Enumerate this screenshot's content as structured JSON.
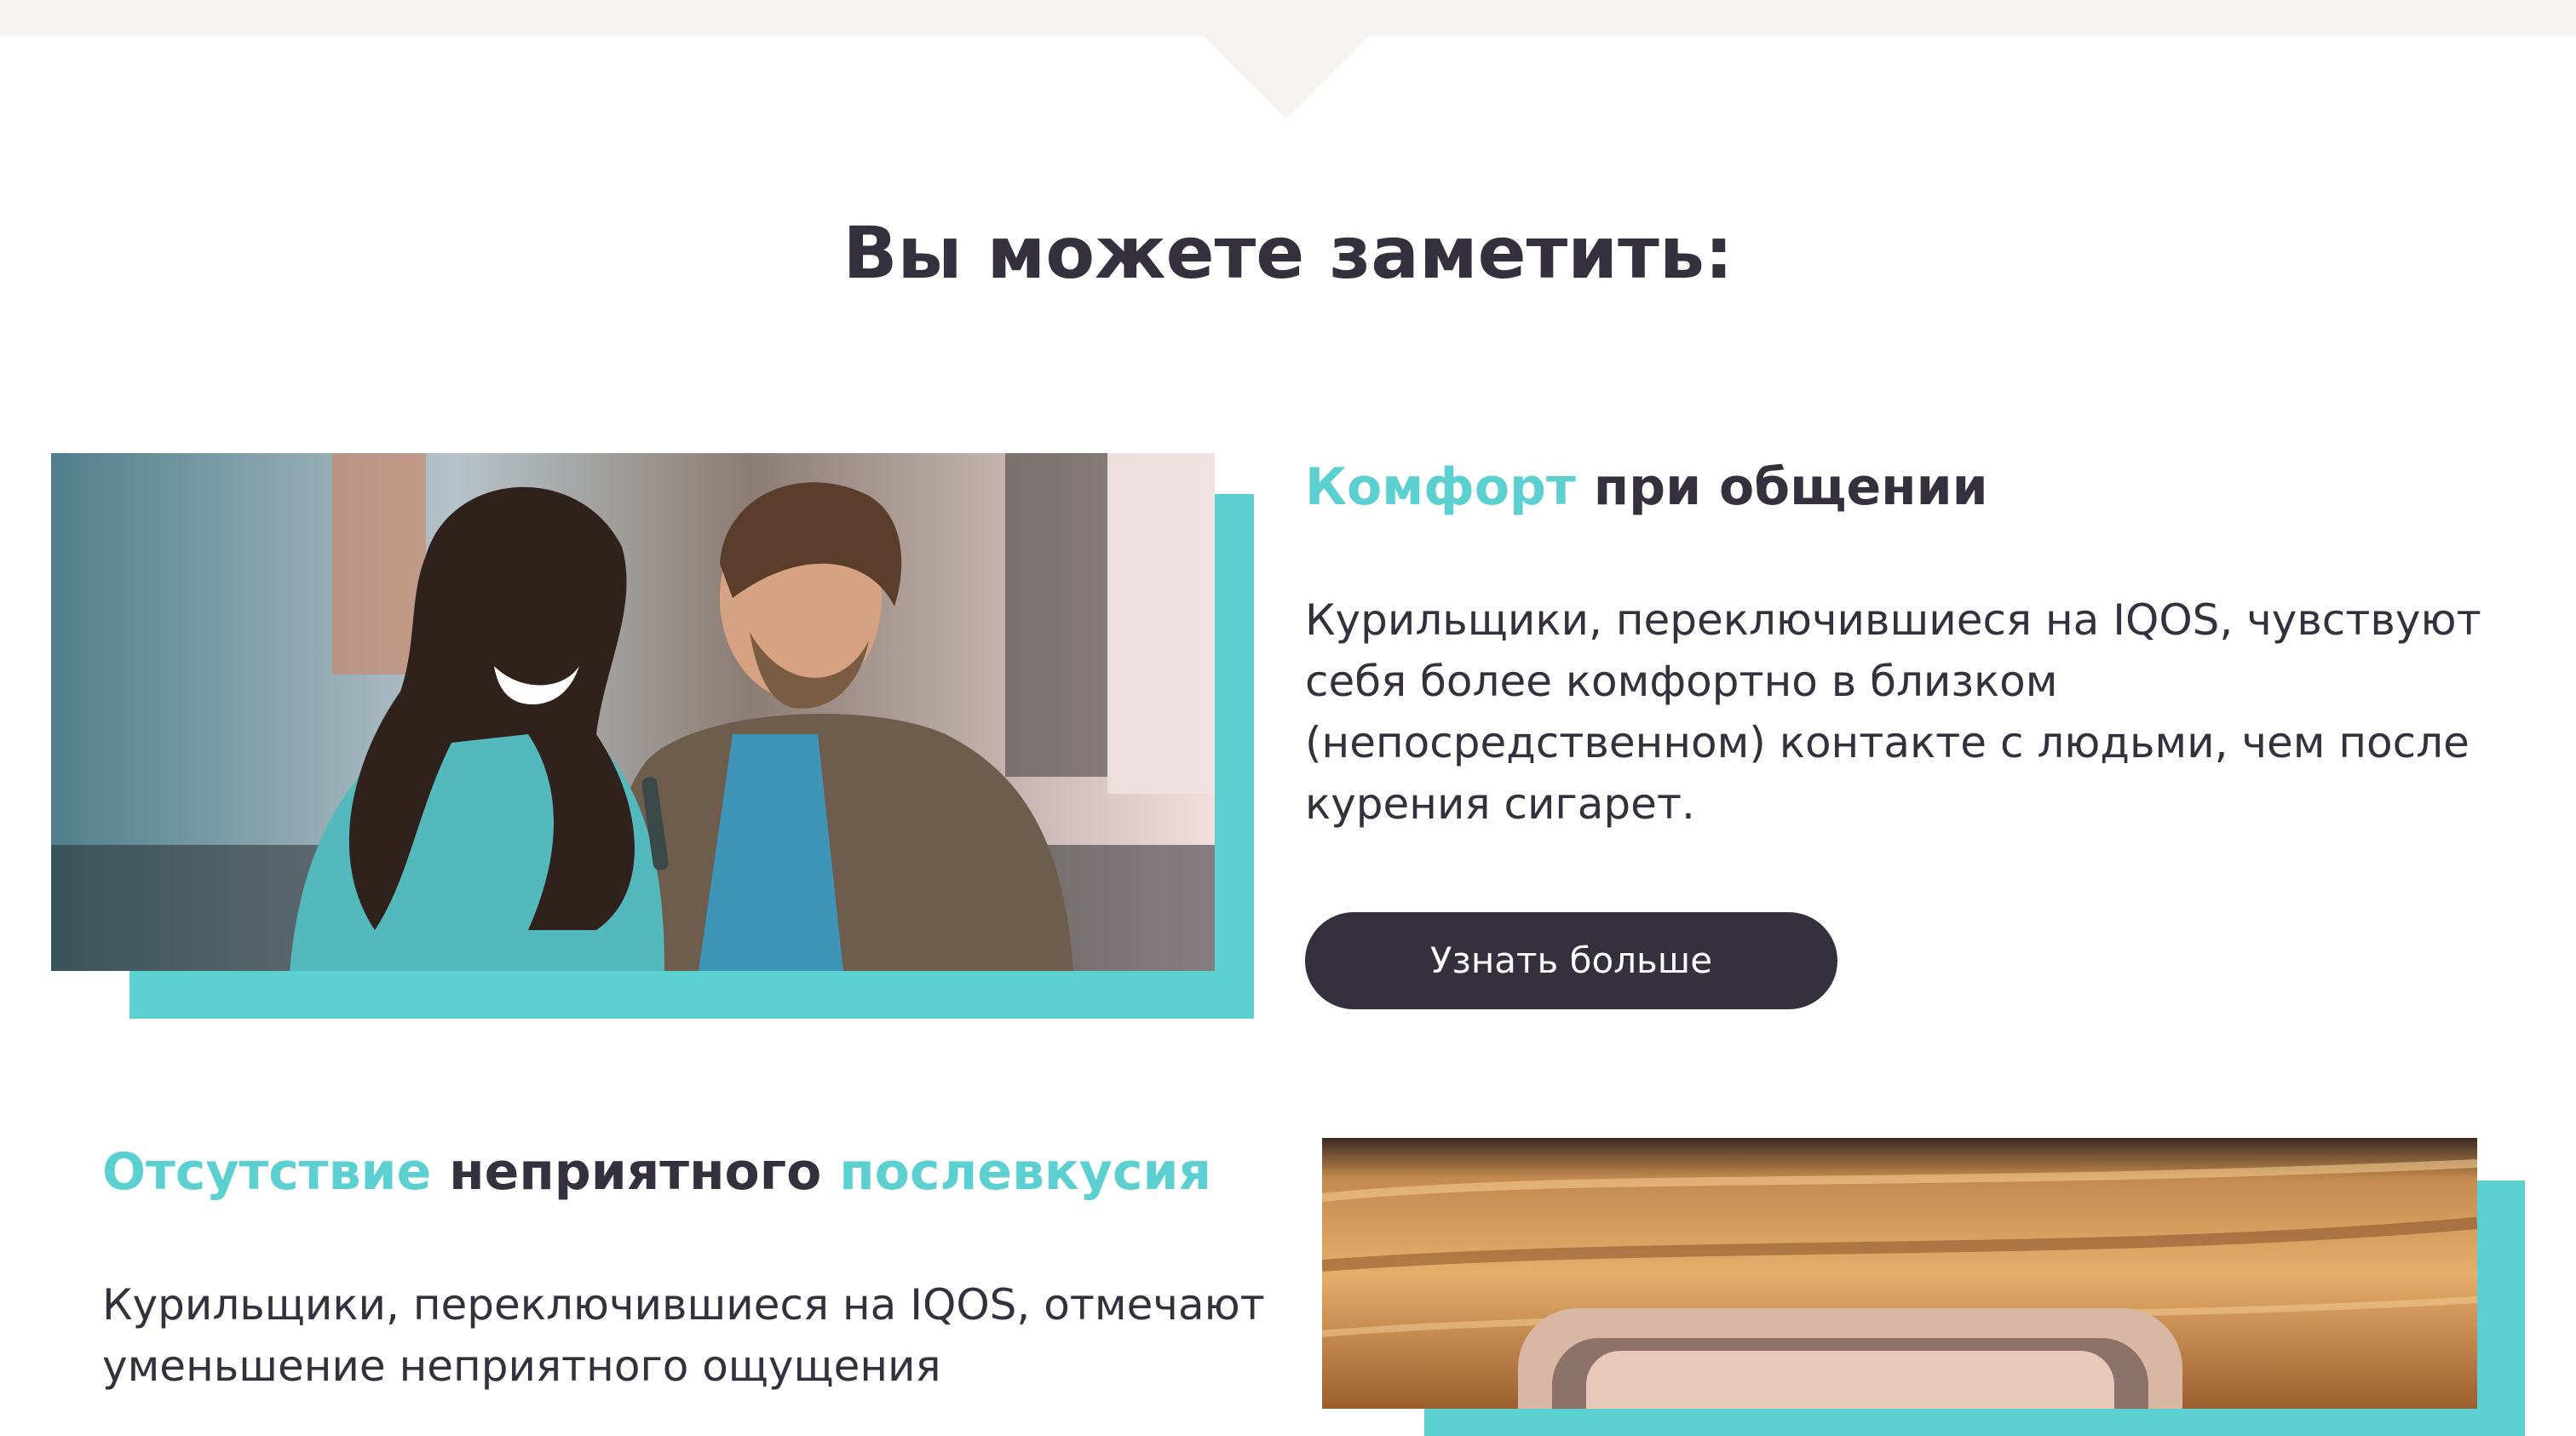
{
  "section": {
    "title": "Вы можете заметить:"
  },
  "feature1": {
    "heading_accent": "Комфорт",
    "heading_rest": "при общении",
    "body": "Курильщики, переключившиеся на IQOS, чувствуют себя более комфортно в близком (непосредственном) контакте с людьми, чем после курения сигарет.",
    "button_label": "Узнать больше"
  },
  "feature2": {
    "heading_part1": "Отсутствие",
    "heading_part2": "неприятного",
    "heading_part3": "послевкусия",
    "body": "Курильщики, переключившиеся на IQOS, отмечают уменьшение неприятного ощущения"
  },
  "colors": {
    "accent": "#5ccfd1",
    "dark": "#34303d",
    "band": "#f6f4f0"
  }
}
